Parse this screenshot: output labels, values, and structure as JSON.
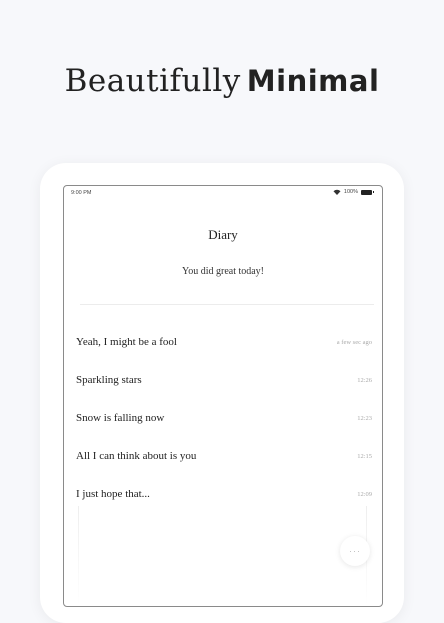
{
  "headline": {
    "light": "Beautifully",
    "bold": "Minimal"
  },
  "statusbar": {
    "time": "9:00 PM",
    "battery": "100%"
  },
  "diary": {
    "title": "Diary",
    "subtitle": "You did great today!",
    "entries": [
      {
        "text": "Yeah, I might be a fool",
        "time": "a few sec ago"
      },
      {
        "text": "Sparkling stars",
        "time": "12:26"
      },
      {
        "text": "Snow is falling now",
        "time": "12:23"
      },
      {
        "text": "All I can think about is you",
        "time": "12:15"
      },
      {
        "text": "I just hope that...",
        "time": "12:09"
      }
    ]
  },
  "fab": {
    "label": "···",
    "icon": "more-icon"
  }
}
